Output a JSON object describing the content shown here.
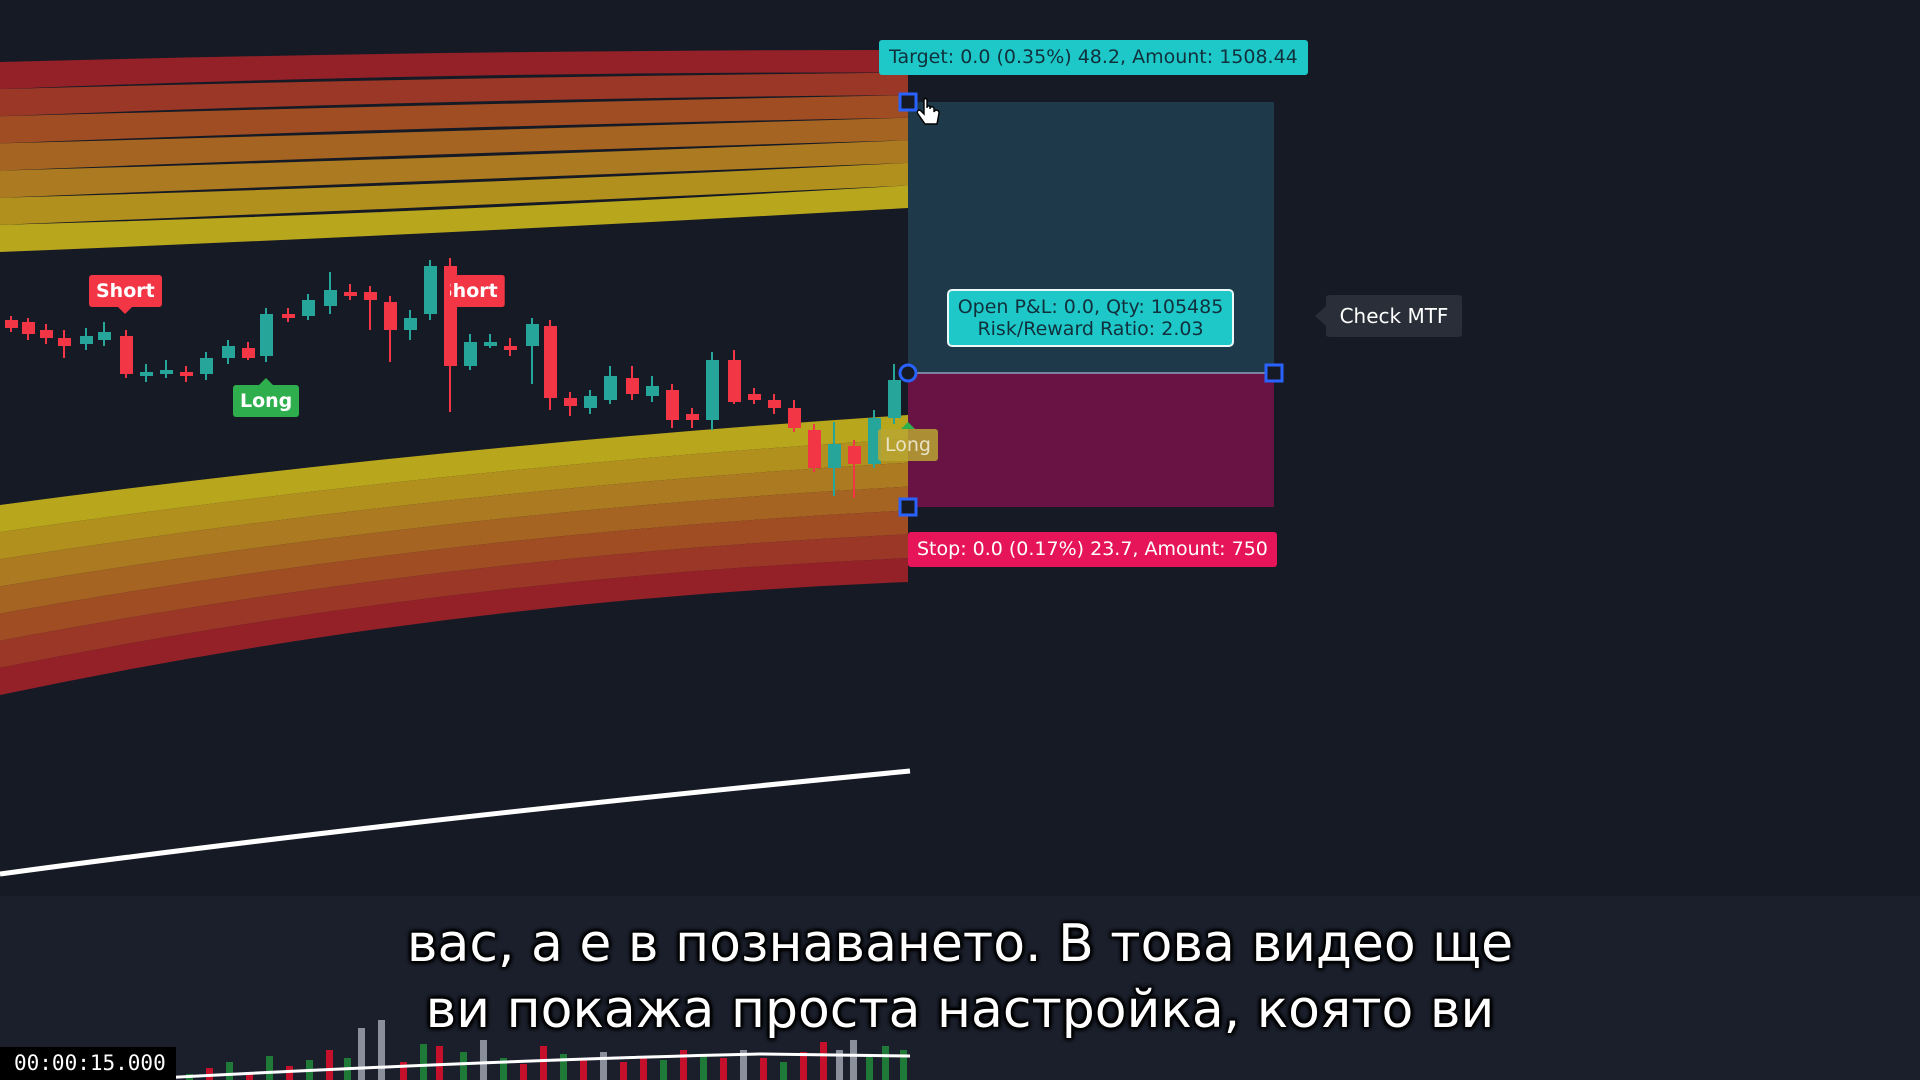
{
  "position_tool": {
    "target_label": "Target: 0.0 (0.35%) 48.2, Amount: 1508.44",
    "stop_label": "Stop: 0.0 (0.17%) 23.7, Amount: 750",
    "pnl_line1": "Open P&L: 0.0, Qty: 105485",
    "pnl_line2": "Risk/Reward Ratio: 2.03",
    "target_color": "#1ec8c8",
    "stop_color": "#e6155a"
  },
  "signals": {
    "short_1": "Short",
    "short_2": "Short",
    "long_1": "Long",
    "long_2": "Long"
  },
  "alert_button": "Check MTF",
  "subtitles": {
    "line1": "вас, а е в познаването. В това видео ще",
    "line2": "ви покажа проста настройка, която ви"
  },
  "timestamp": "00:00:15.000",
  "colors": {
    "background": "#161a25",
    "bull": "#26a69a",
    "bear": "#f23645",
    "band_outer": "#8e0b2a",
    "band_inner": "#b8a61c"
  },
  "chart_data": {
    "type": "candlestick",
    "series": [
      {
        "name": "price",
        "type": "candlestick"
      },
      {
        "name": "upper band",
        "type": "area"
      },
      {
        "name": "lower band",
        "type": "area"
      },
      {
        "name": "trend line",
        "type": "line"
      },
      {
        "name": "volume",
        "type": "bar"
      }
    ]
  }
}
